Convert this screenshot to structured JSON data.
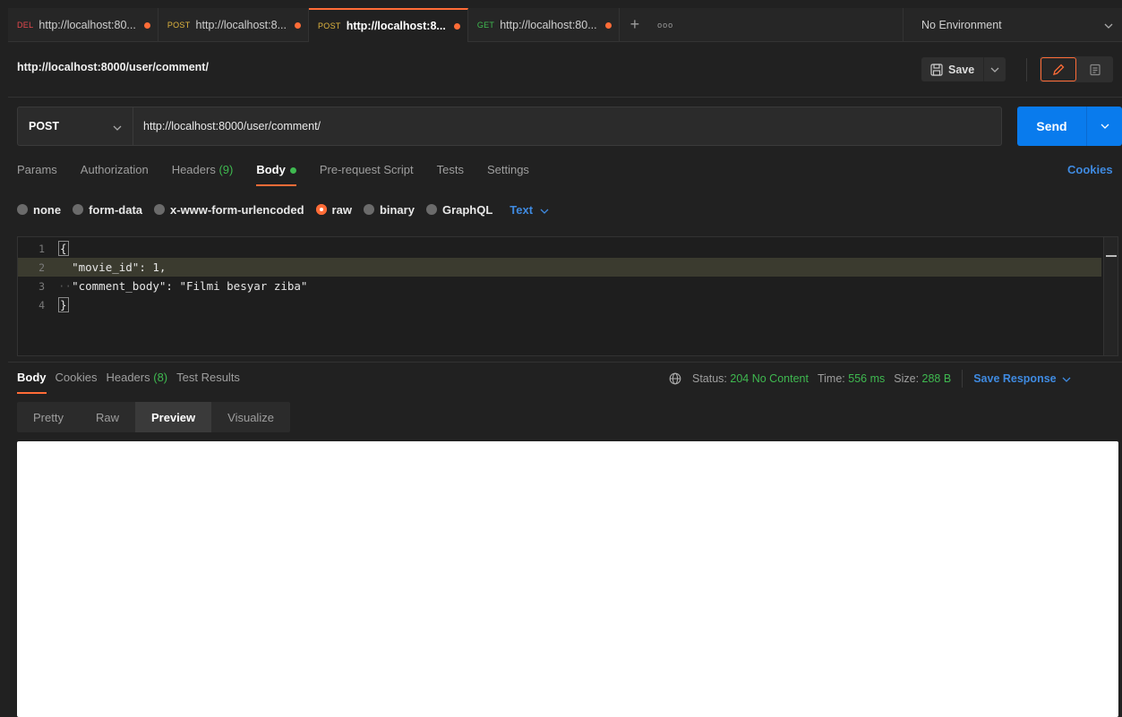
{
  "tabs": [
    {
      "method": "DEL",
      "method_color": "#e5484d",
      "url": "http://localhost:80..."
    },
    {
      "method": "POST",
      "method_color": "#e0b53f",
      "url": "http://localhost:8..."
    },
    {
      "method": "POST",
      "method_color": "#e0b53f",
      "url": "http://localhost:8...",
      "active": true
    },
    {
      "method": "GET",
      "method_color": "#3fb950",
      "url": "http://localhost:80..."
    }
  ],
  "tab_add": "+",
  "tab_more": "ooo",
  "environment": {
    "label": "No Environment"
  },
  "request": {
    "title": "http://localhost:8000/user/comment/",
    "save_label": "Save",
    "method": "POST",
    "url": "http://localhost:8000/user/comment/",
    "send_label": "Send"
  },
  "request_tabs": [
    {
      "label": "Params"
    },
    {
      "label": "Authorization"
    },
    {
      "label": "Headers",
      "count": "(9)"
    },
    {
      "label": "Body",
      "active": true
    },
    {
      "label": "Pre-request Script"
    },
    {
      "label": "Tests"
    },
    {
      "label": "Settings"
    }
  ],
  "cookies_label": "Cookies",
  "body_types": [
    "none",
    "form-data",
    "x-www-form-urlencoded",
    "raw",
    "binary",
    "GraphQL"
  ],
  "body_type_selected": "raw",
  "body_format": "Text",
  "editor": {
    "line_numbers": [
      "1",
      "2",
      "3",
      "4"
    ],
    "lines": [
      "{",
      "\"movie_id\": 1,",
      "\"comment_body\": \"Filmi besyar ziba\"",
      "}"
    ]
  },
  "response_tabs": [
    {
      "label": "Body",
      "active": true
    },
    {
      "label": "Cookies"
    },
    {
      "label": "Headers",
      "count": "(8)"
    },
    {
      "label": "Test Results"
    }
  ],
  "response_status": {
    "status_label": "Status:",
    "status_value": "204 No Content",
    "time_label": "Time:",
    "time_value": "556 ms",
    "size_label": "Size:",
    "size_value": "288 B",
    "save_response": "Save Response"
  },
  "response_modes": [
    "Pretty",
    "Raw",
    "Preview",
    "Visualize"
  ],
  "response_mode_selected": "Preview",
  "colors": {
    "accent": "#ff6c37",
    "primary_blue": "#097bed",
    "link_blue": "#3f8ae0",
    "success_green": "#3fb950",
    "background": "#212121"
  }
}
